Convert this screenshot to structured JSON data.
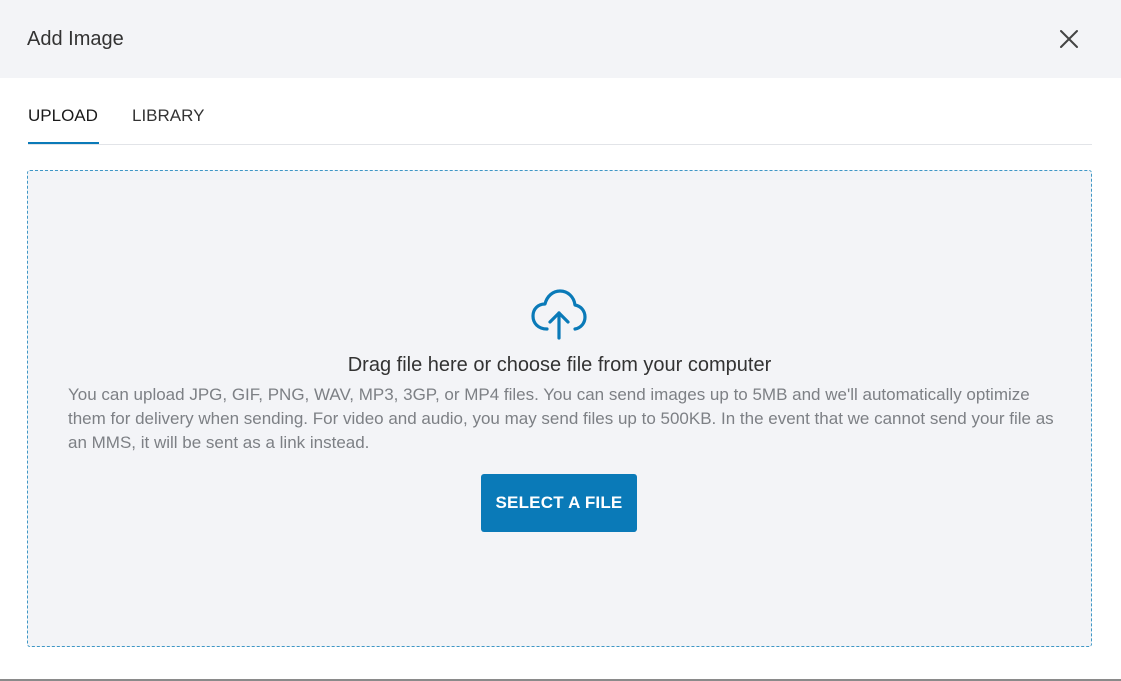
{
  "modal": {
    "title": "Add Image"
  },
  "tabs": [
    {
      "label": "UPLOAD",
      "active": true
    },
    {
      "label": "LIBRARY",
      "active": false
    }
  ],
  "dropzone": {
    "icon": "cloud-upload-icon",
    "heading": "Drag file here or choose file from your computer",
    "help": "You can upload JPG, GIF, PNG, WAV, MP3, 3GP, or MP4 files. You can send images up to 5MB and we'll automatically optimize them for delivery when sending. For video and audio, you may send files up to 500KB. In the event that we cannot send your file as an MMS, it will be sent as a link instead.",
    "button_label": "SELECT A FILE"
  },
  "colors": {
    "accent": "#0a7ab8",
    "header_bg": "#f3f4f7",
    "dropzone_border": "#3e97c6",
    "help_text": "#7d8085"
  }
}
